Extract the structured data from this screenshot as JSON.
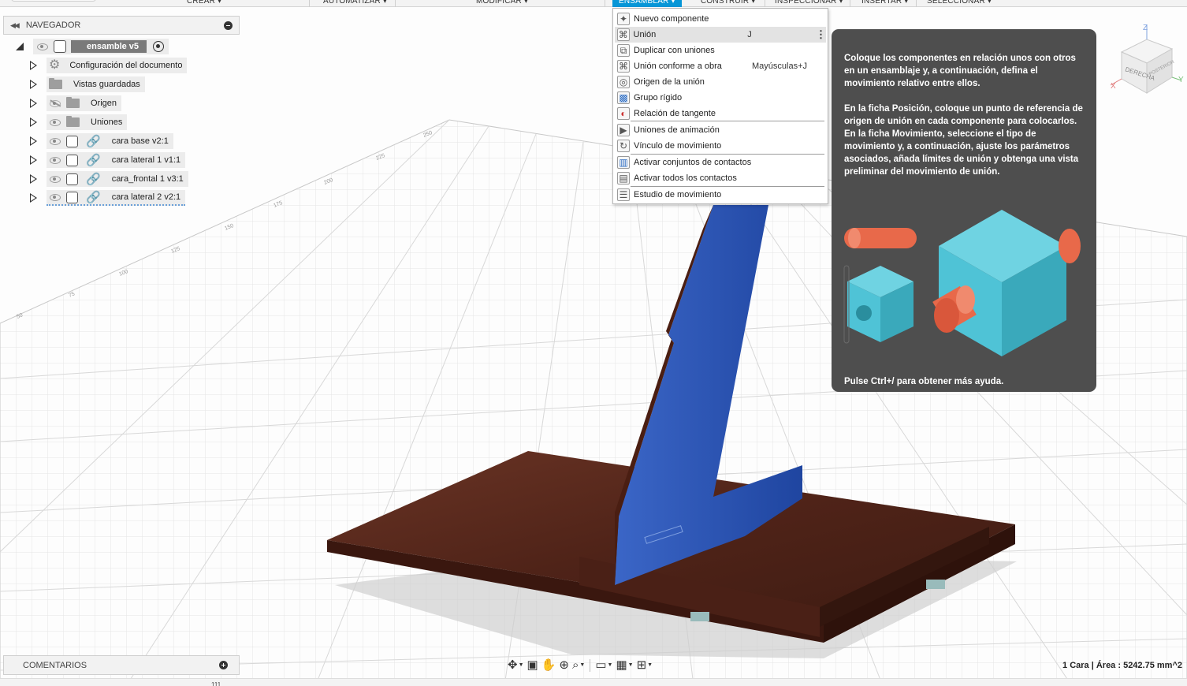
{
  "toolbar": {
    "items": [
      "CREAR ▾",
      "AUTOMATIZAR ▾",
      "MODIFICAR ▾",
      "ENSAMBLAR ▾",
      "CONSTRUIR ▾",
      "INSPECCIONAR ▾",
      "INSERTAR ▾",
      "SELECCIONAR ▾"
    ],
    "active": "ENSAMBLAR ▾"
  },
  "navigator": {
    "title": "NAVEGADOR",
    "root": "ensamble v5",
    "items": [
      {
        "label": "Configuración del documento",
        "icon": "gear-icon"
      },
      {
        "label": "Vistas guardadas",
        "icon": "folder-icon"
      },
      {
        "label": "Origen",
        "icon": "folder-icon",
        "visibility": "hidden"
      },
      {
        "label": "Uniones",
        "icon": "folder-icon"
      },
      {
        "label": "cara base v2:1",
        "icon": "component-icon"
      },
      {
        "label": "cara lateral 1 v1:1",
        "icon": "component-icon"
      },
      {
        "label": "cara_frontal 1 v3:1",
        "icon": "component-icon"
      },
      {
        "label": "cara lateral 2 v2:1",
        "icon": "component-icon"
      }
    ]
  },
  "comments": {
    "title": "COMENTARIOS"
  },
  "menu": {
    "items": [
      {
        "label": "Nuevo componente",
        "shortcut": "",
        "icon": "new-component-icon"
      },
      {
        "label": "Unión",
        "shortcut": "J",
        "icon": "joint-icon",
        "highlighted": true,
        "more": "⋮"
      },
      {
        "label": "Duplicar con uniones",
        "shortcut": "",
        "icon": "duplicate-joints-icon"
      },
      {
        "label": "Unión conforme a obra",
        "shortcut": "Mayúsculas+J",
        "icon": "as-built-joint-icon"
      },
      {
        "label": "Origen de la unión",
        "shortcut": "",
        "icon": "joint-origin-icon"
      },
      {
        "label": "Grupo rígido",
        "shortcut": "",
        "icon": "rigid-group-icon"
      },
      {
        "label": "Relación de tangente",
        "shortcut": "",
        "icon": "tangent-relation-icon"
      },
      {
        "label": "Uniones de animación",
        "shortcut": "",
        "icon": "animate-joints-icon"
      },
      {
        "label": "Vínculo de movimiento",
        "shortcut": "",
        "icon": "motion-link-icon"
      },
      {
        "label": "Activar conjuntos de contactos",
        "shortcut": "",
        "icon": "contact-sets-icon"
      },
      {
        "label": "Activar todos los contactos",
        "shortcut": "",
        "icon": "all-contacts-icon"
      },
      {
        "label": "Estudio de movimiento",
        "shortcut": "",
        "icon": "motion-study-icon"
      }
    ]
  },
  "tooltip": {
    "p1": "Coloque los componentes en relación unos con otros en un ensamblaje y, a continuación, defina el movimiento relativo entre ellos.",
    "p2": "En la ficha Posición, coloque un punto de referencia de origen de unión en cada componente para colocarlos. En la ficha Movimiento, seleccione el tipo de movimiento y, a continuación, ajuste los parámetros asociados, añada límites de unión y obtenga una vista preliminar del movimiento de unión.",
    "footer": "Pulse Ctrl+/ para obtener más ayuda."
  },
  "viewcube": {
    "face_front": "DERECHA",
    "face_side": "POSTERIOR",
    "axis_x": "X",
    "axis_y": "Y",
    "axis_z": "Z"
  },
  "status": {
    "text": "1 Cara | Área : 5242.75 mm^2"
  },
  "ruler": {
    "labels": [
      "250",
      "225",
      "200",
      "175",
      "150",
      "125",
      "100",
      "75",
      "50",
      "25",
      "0"
    ]
  },
  "bottom_mark": "111",
  "colors": {
    "accent": "#0696d7",
    "panel_blue": "#2c55b5",
    "wood": "#5a2a1e",
    "tooltip_bg": "#4e4e4e",
    "cube_cyan": "#4fc3d6",
    "cylinder_orange": "#e8694a"
  }
}
